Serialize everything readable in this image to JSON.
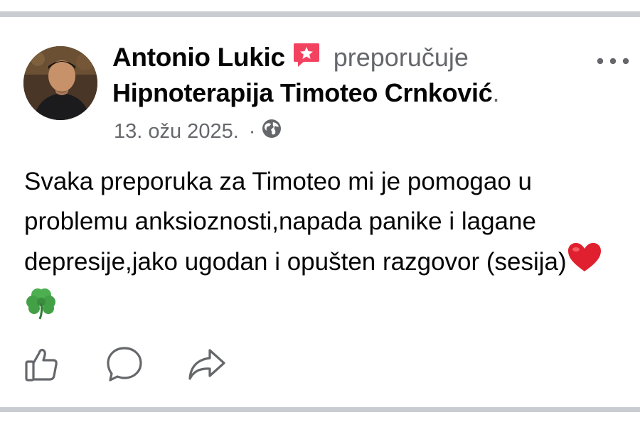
{
  "post": {
    "author": "Antonio Lukic",
    "action": "preporučuje",
    "page_name": "Hipnoterapija Timoteo Crnković",
    "page_suffix": ".",
    "date": "13. ožu 2025.",
    "separator": "·",
    "privacy_icon": "globe-icon",
    "text": "Svaka preporuka za Timoteo mi je pomogao u problemu anksioznosti,napada panike i lagane depresije,jako ugodan i opušten razgovor (sesija)",
    "emojis": [
      "heart-emoji",
      "shamrock-emoji"
    ]
  },
  "actions": {
    "like_icon": "thumbs-up-icon",
    "comment_icon": "comment-icon",
    "share_icon": "share-icon"
  },
  "colors": {
    "badge": "#f3425f",
    "secondary_text": "#65676b",
    "divider": "#c9ccd1",
    "heart": "#e0202e",
    "shamrock": "#4caf50"
  }
}
